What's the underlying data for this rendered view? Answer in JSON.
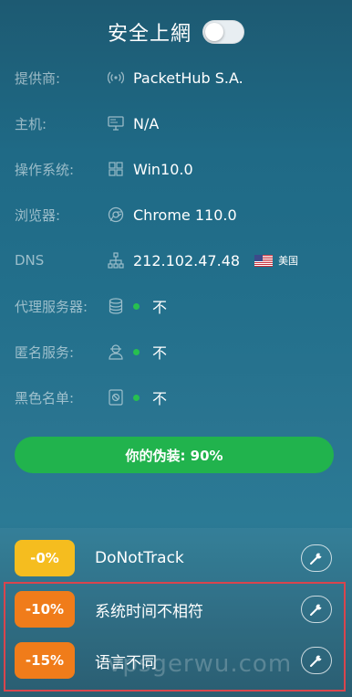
{
  "header": {
    "title": "安全上網",
    "toggle_on": false
  },
  "info": [
    {
      "label": "提供商:",
      "icon": "signal-icon",
      "value": "PacketHub S.A."
    },
    {
      "label": "主机:",
      "icon": "monitor-icon",
      "value": "N/A"
    },
    {
      "label": "操作系统:",
      "icon": "windows-icon",
      "value": "Win10.0"
    },
    {
      "label": "浏览器:",
      "icon": "chrome-icon",
      "value": "Chrome 110.0"
    },
    {
      "label": "DNS",
      "icon": "network-icon",
      "value": "212.102.47.48",
      "flag_label": "美国"
    },
    {
      "label": "代理服务器:",
      "icon": "database-icon",
      "value": "不"
    },
    {
      "label": "匿名服务:",
      "icon": "user-hidden-icon",
      "value": "不"
    },
    {
      "label": "黑色名单:",
      "icon": "blacklist-icon",
      "value": "不"
    }
  ],
  "camouflage": {
    "text": "你的伪装: 90%",
    "percent": 90
  },
  "penalties": [
    {
      "badge": "-0%",
      "label": "DoNotTrack",
      "color": "#f5bd1f"
    },
    {
      "badge": "-10%",
      "label": "系统时间不相符",
      "color": "#f07c1a"
    },
    {
      "badge": "-15%",
      "label": "语言不同",
      "color": "#f07c1a"
    }
  ],
  "watermark": "vpsgerwu.com",
  "colors": {
    "green": "#21b34d",
    "yellow": "#f5bd1f",
    "orange": "#f07c1a",
    "highlight": "#d9454d"
  }
}
